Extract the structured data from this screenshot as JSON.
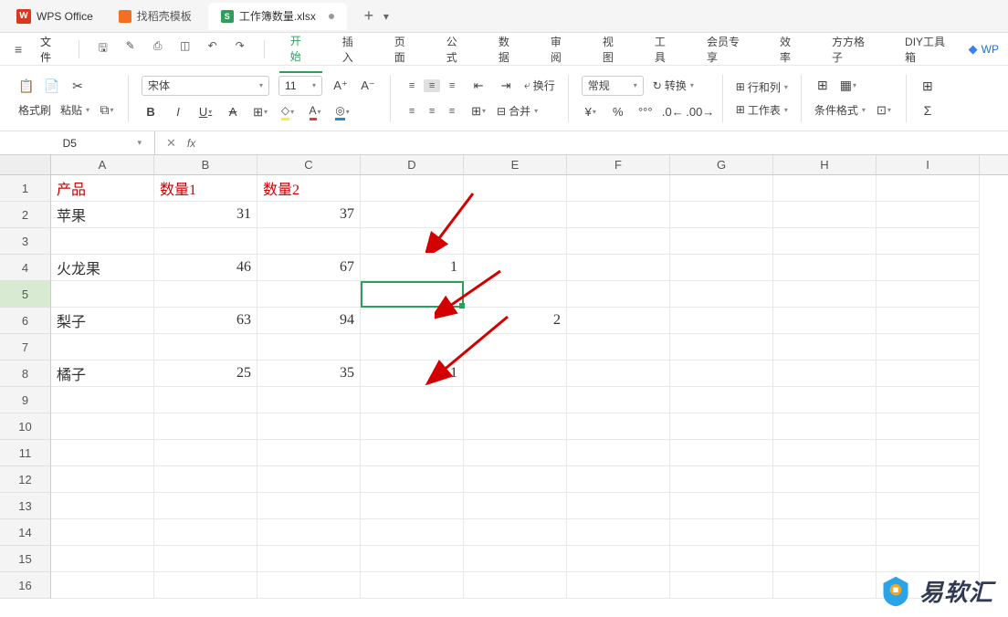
{
  "app": {
    "name": "WPS Office"
  },
  "tabs": [
    {
      "label": "找稻壳模板"
    },
    {
      "label": "工作簿数量.xlsx"
    }
  ],
  "tab_add": "+",
  "menu": {
    "file": "文件",
    "items": [
      "开始",
      "插入",
      "页面",
      "公式",
      "数据",
      "审阅",
      "视图",
      "工具",
      "会员专享",
      "效率",
      "方方格子",
      "DIY工具箱"
    ],
    "active_index": 0,
    "wp_label": "WP"
  },
  "ribbon": {
    "format_painter": "格式刷",
    "paste": "粘贴",
    "font_name": "宋体",
    "font_size": "11",
    "wrap": "换行",
    "merge": "合并",
    "number_format": "常规",
    "convert": "转换",
    "rows_cols": "行和列",
    "worksheet": "工作表",
    "cond_format": "条件格式"
  },
  "namebox": "D5",
  "chart_data": {
    "type": "table",
    "headers": [
      "产品",
      "数量1",
      "数量2"
    ],
    "rows": [
      {
        "产品": "苹果",
        "数量1": 31,
        "数量2": 37
      },
      {
        "产品": "火龙果",
        "数量1": 46,
        "数量2": 67
      },
      {
        "产品": "梨子",
        "数量1": 63,
        "数量2": 94
      },
      {
        "产品": "橘子",
        "数量1": 25,
        "数量2": 35
      }
    ]
  },
  "sheet": {
    "columns": [
      "A",
      "B",
      "C",
      "D",
      "E",
      "F",
      "G",
      "H",
      "I"
    ],
    "selected_cell": "D5",
    "selected_row": 5,
    "cells": {
      "A1": "产品",
      "B1": "数量1",
      "C1": "数量2",
      "A2": "苹果",
      "B2": "31",
      "C2": "37",
      "A4": "火龙果",
      "B4": "46",
      "C4": "67",
      "D4": "1",
      "A6": "梨子",
      "B6": "63",
      "C6": "94",
      "E6": "2",
      "A8": "橘子",
      "B8": "25",
      "C8": "35",
      "D8": "1"
    }
  },
  "watermark": "易软汇"
}
